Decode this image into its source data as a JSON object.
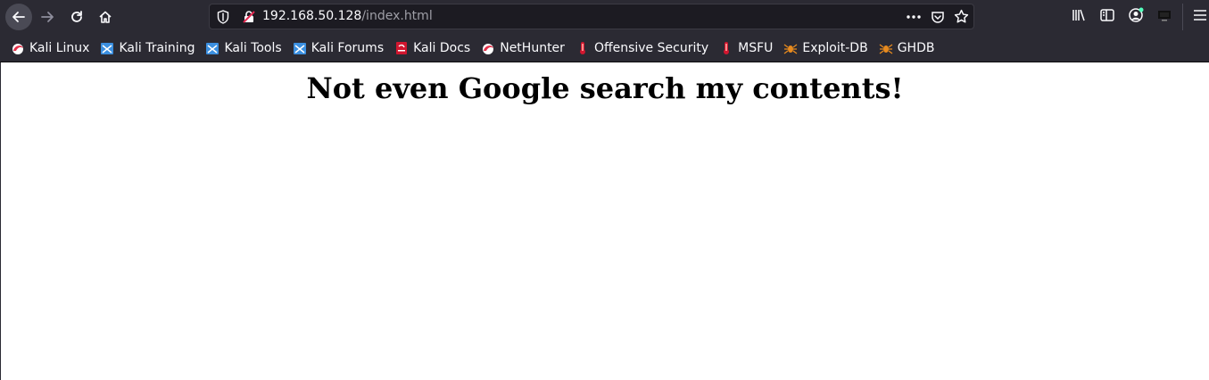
{
  "browser": {
    "url_host": "192.168.50.128",
    "url_path": "/index.html"
  },
  "bookmarks": [
    {
      "label": "Kali Linux",
      "icon": "kali-dragon-icon"
    },
    {
      "label": "Kali Training",
      "icon": "kali-training-icon"
    },
    {
      "label": "Kali Tools",
      "icon": "kali-tools-icon"
    },
    {
      "label": "Kali Forums",
      "icon": "kali-forums-icon"
    },
    {
      "label": "Kali Docs",
      "icon": "kali-docs-icon"
    },
    {
      "label": "NetHunter",
      "icon": "nethunter-icon"
    },
    {
      "label": "Offensive Security",
      "icon": "offsec-icon"
    },
    {
      "label": "MSFU",
      "icon": "msfu-icon"
    },
    {
      "label": "Exploit-DB",
      "icon": "exploit-db-icon"
    },
    {
      "label": "GHDB",
      "icon": "ghdb-icon"
    }
  ],
  "page": {
    "heading": "Not even Google search my contents!"
  },
  "colors": {
    "chrome_bg": "#2b2a33",
    "urlbar_bg": "#1c1b22",
    "text_light": "#fbfbfe",
    "url_path": "#9e9ea6",
    "kali_red": "#e4304a",
    "kali_blue": "#3b8fe0",
    "orange": "#e78a1e"
  }
}
